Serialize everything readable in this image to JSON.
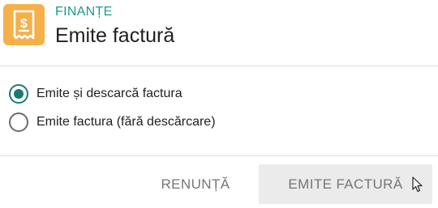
{
  "header": {
    "icon": "receipt-dollar-icon",
    "category": "FINANȚE",
    "title": "Emite factură"
  },
  "options": [
    {
      "label": "Emite și descarcă factura",
      "selected": true
    },
    {
      "label": "Emite factura (fără descărcare)",
      "selected": false
    }
  ],
  "actions": {
    "cancel_label": "RENUNȚĂ",
    "confirm_label": "EMITE FACTURĂ"
  },
  "colors": {
    "accent": "#1a9c8c",
    "radio_selected": "#1a7a72",
    "icon_background": "#f6b04a",
    "button_background": "#ebebeb",
    "button_text": "#757575"
  }
}
